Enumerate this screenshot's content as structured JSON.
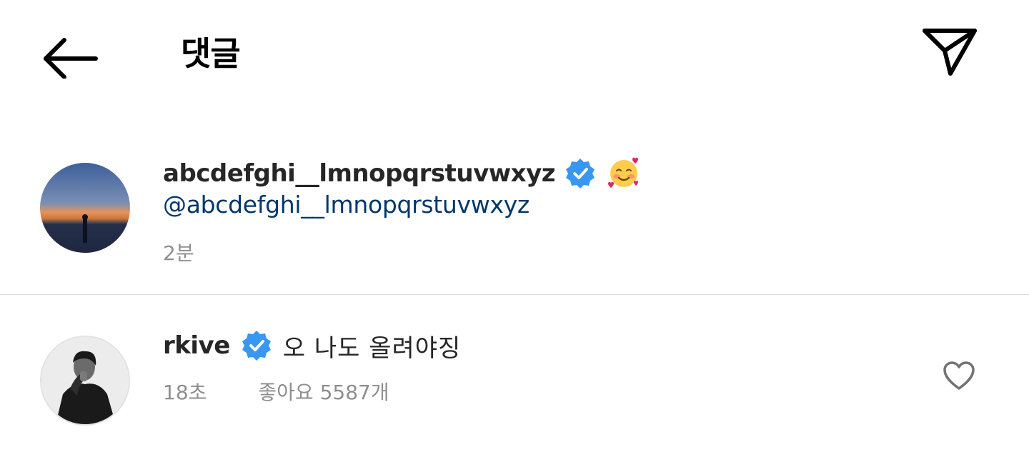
{
  "header": {
    "title": "댓글",
    "back_icon": "arrow-left-icon",
    "send_icon": "paper-plane-icon"
  },
  "caption": {
    "username": "abcdefghi__lmnopqrstuvwxyz",
    "verified": true,
    "emoji": "🥰",
    "mention": "@abcdefghi__lmnopqrstuvwxyz",
    "time": "2분"
  },
  "comment": {
    "username": "rkive",
    "verified": true,
    "text": "오 나도 올려야징",
    "time": "18초",
    "likes": "좋아요 5587개"
  },
  "colors": {
    "verified_blue": "#3897f0",
    "mention_blue": "#00376b",
    "muted_gray": "#8e8e8e",
    "divider": "#dbdbdb"
  }
}
